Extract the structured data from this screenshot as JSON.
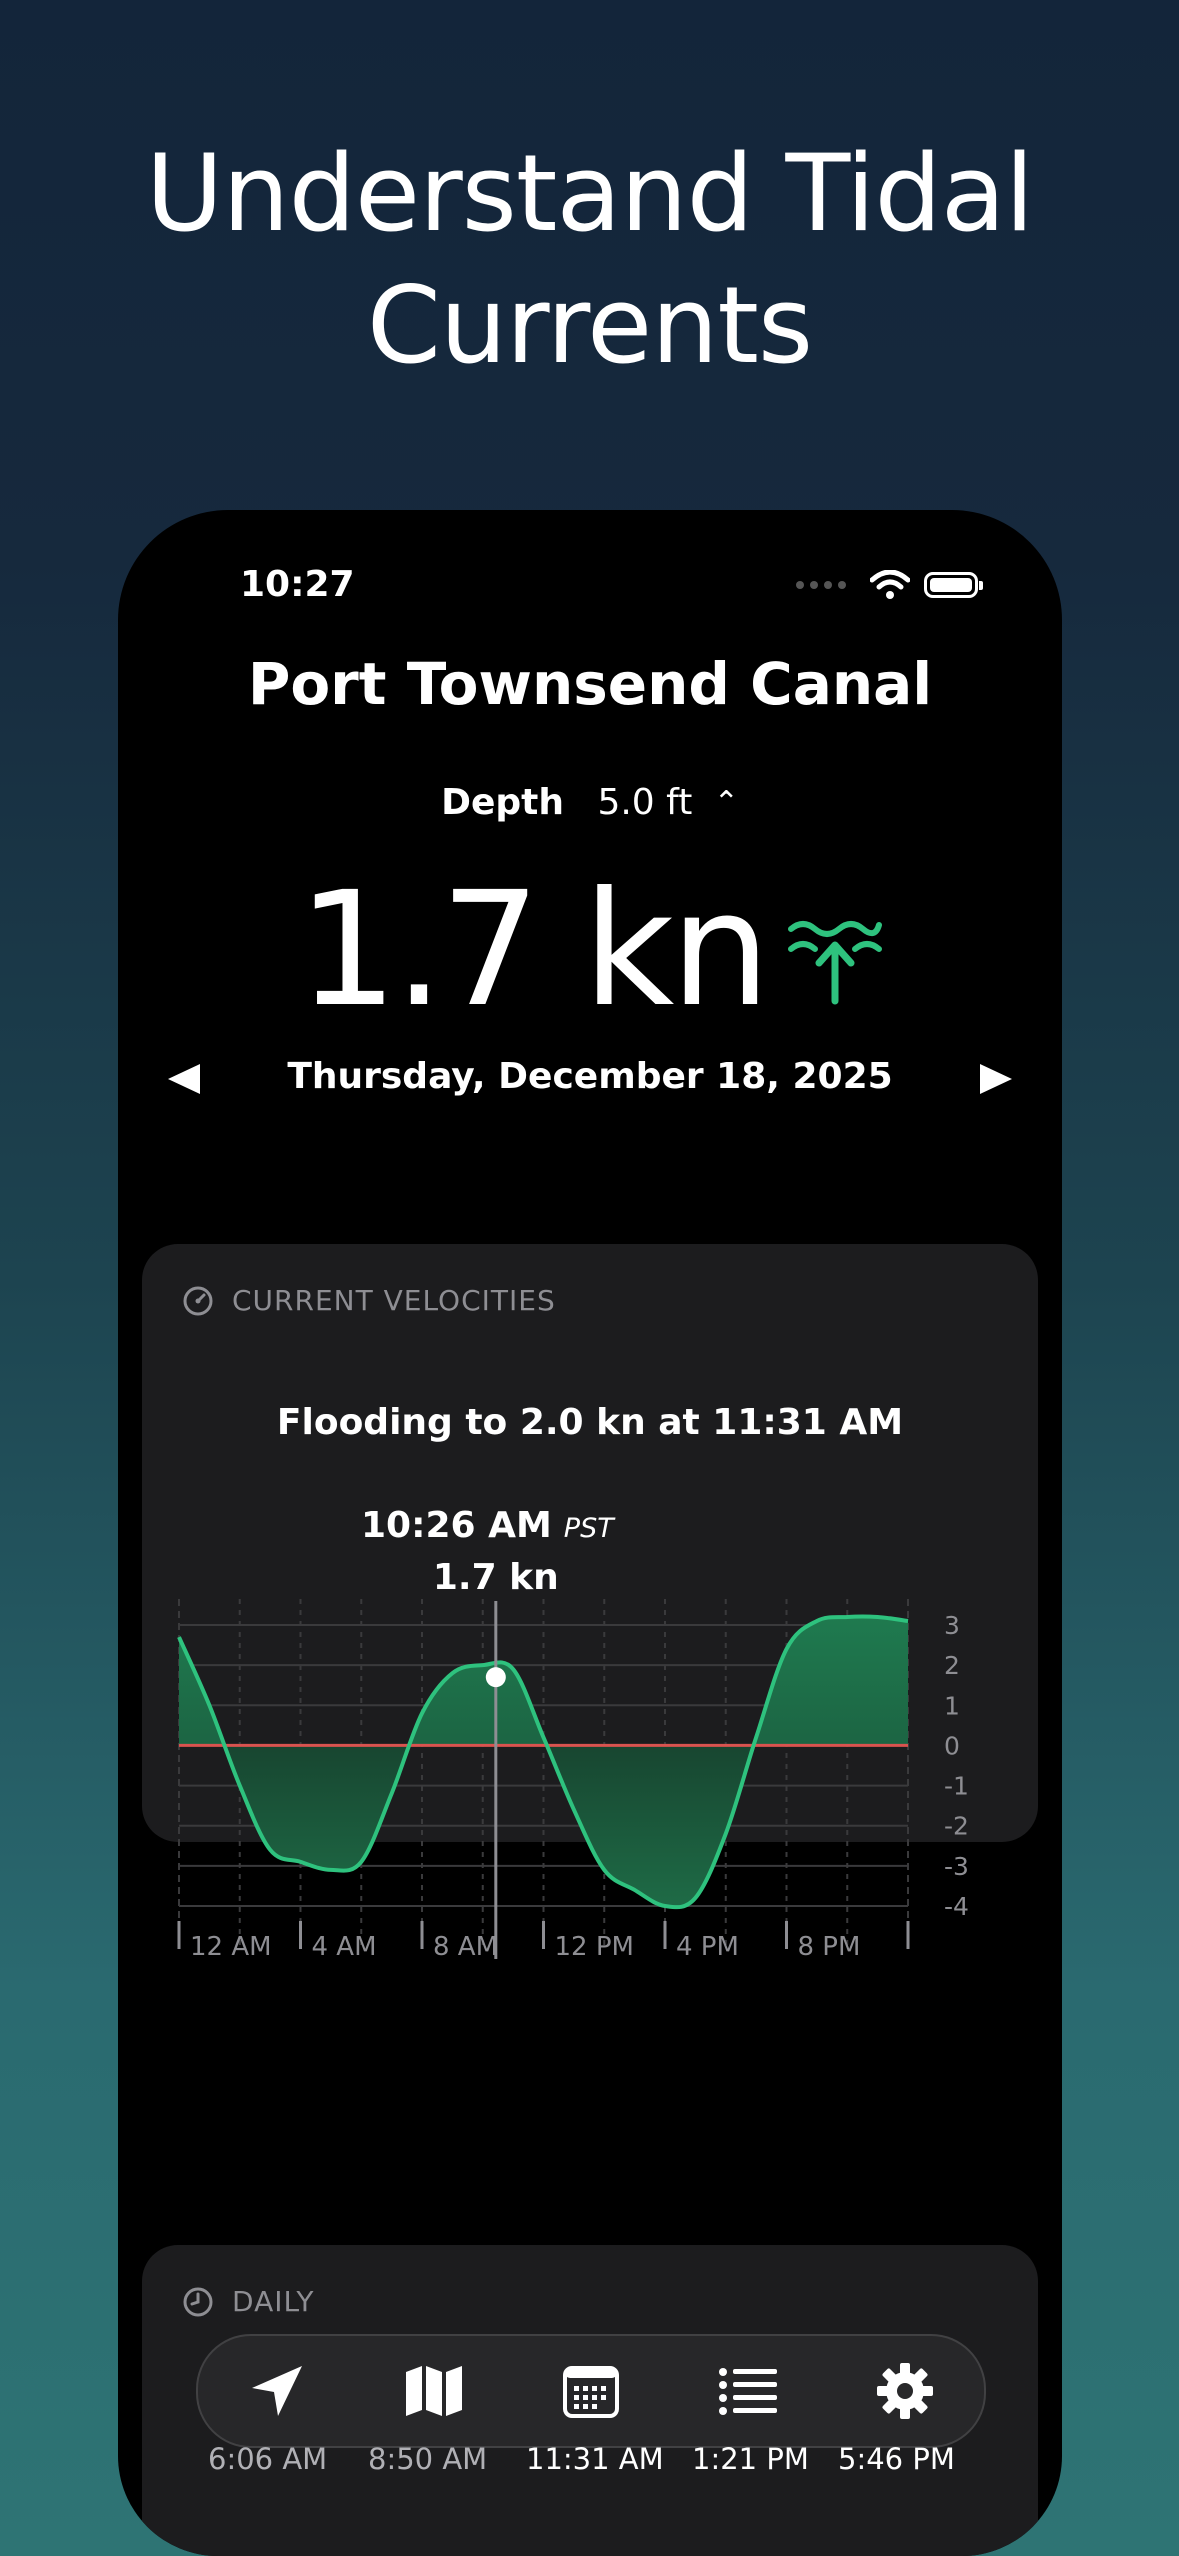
{
  "headline_line1": "Understand Tidal",
  "headline_line2": "Currents",
  "status": {
    "time": "10:27"
  },
  "station": {
    "name": "Port Townsend Canal"
  },
  "depth": {
    "label": "Depth",
    "value": "5.0 ft"
  },
  "current_speed": "1.7 kn",
  "direction_icon": "flood-arrow-icon",
  "date": "Thursday, December 18, 2025",
  "velocities_card": {
    "title": "CURRENT VELOCITIES",
    "subtitle": "Flooding to 2.0 kn at 11:31 AM",
    "cursor_time": "10:26 AM",
    "cursor_tz": "PST",
    "cursor_value": "1.7 kn"
  },
  "chart_data": {
    "type": "area",
    "x": [
      0,
      1,
      2,
      3,
      4,
      5,
      6,
      7,
      8,
      9,
      10,
      11,
      12,
      13,
      14,
      15,
      16,
      17,
      18,
      19,
      20,
      21,
      22,
      23,
      24
    ],
    "series": [
      {
        "values": [
          2.7,
          1.0,
          -1.0,
          -2.6,
          -2.9,
          -3.1,
          -2.9,
          -1.2,
          0.8,
          1.8,
          2.0,
          1.9,
          0.2,
          -1.6,
          -3.1,
          -3.6,
          -4.0,
          -3.8,
          -2.2,
          0.2,
          2.4,
          3.1,
          3.2,
          3.2,
          3.1
        ]
      }
    ],
    "x_tick_labels": [
      "12 AM",
      "4 AM",
      "8 AM",
      "12 PM",
      "4 PM",
      "8 PM"
    ],
    "x_ticks": [
      0,
      4,
      8,
      12,
      16,
      20
    ],
    "y_ticks": [
      3,
      2,
      1,
      0,
      -1,
      -2,
      -3,
      -4
    ],
    "ylim": [
      -4,
      3
    ],
    "xlim": [
      0,
      24
    ],
    "cursor_x": 10.43,
    "cursor_y": 1.7,
    "colors": {
      "fill": "#1e6b46",
      "line": "#2ec27e",
      "zero_line": "#d9534f"
    },
    "grid": true
  },
  "daily_card": {
    "title": "DAILY"
  },
  "tabbar": {
    "tabs": [
      "location-arrow-icon",
      "map-icon",
      "calendar-icon",
      "list-icon",
      "gear-icon"
    ]
  },
  "daily_times": [
    "6:06 AM",
    "8:50 AM",
    "11:31 AM",
    "1:21 PM",
    "5:46 PM"
  ]
}
